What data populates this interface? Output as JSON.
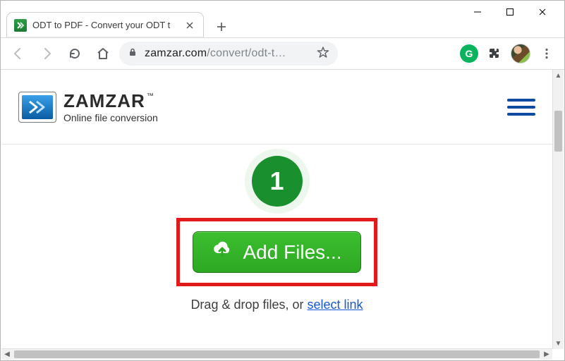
{
  "window": {
    "tab_title": "ODT to PDF - Convert your ODT t"
  },
  "omnibox": {
    "host": "zamzar.com",
    "path": "/convert/odt-t…"
  },
  "ext": {
    "g_label": "G"
  },
  "logo": {
    "brand": "ZAMZAR",
    "tm": "™",
    "tagline": "Online file conversion"
  },
  "main": {
    "step_number": "1",
    "add_files_label": "Add Files...",
    "hint_prefix": "Drag & drop files, or ",
    "hint_link": "select link"
  }
}
